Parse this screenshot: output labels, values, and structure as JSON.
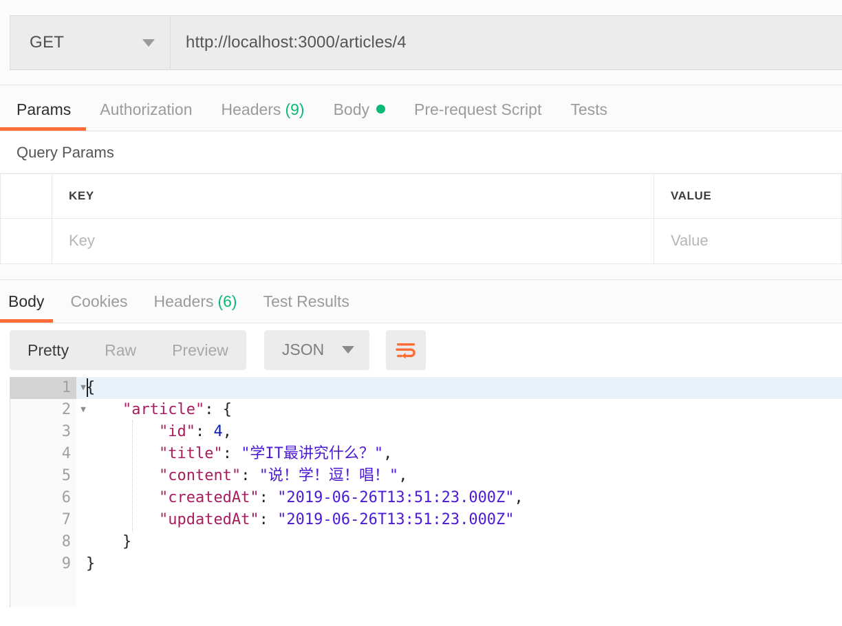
{
  "request": {
    "method": "GET",
    "url": "http://localhost:3000/articles/4",
    "method_caret": "chevron-down-icon",
    "tabs": [
      {
        "label": "Params",
        "active": true,
        "count": "",
        "dot": false
      },
      {
        "label": "Authorization",
        "active": false,
        "count": "",
        "dot": false
      },
      {
        "label": "Headers",
        "active": false,
        "count": "(9)",
        "dot": false
      },
      {
        "label": "Body",
        "active": false,
        "count": "",
        "dot": true
      },
      {
        "label": "Pre-request Script",
        "active": false,
        "count": "",
        "dot": false
      },
      {
        "label": "Tests",
        "active": false,
        "count": "",
        "dot": false
      }
    ]
  },
  "query_params": {
    "section_title": "Query Params",
    "headers": {
      "key": "KEY",
      "value": "VALUE"
    },
    "rows": [
      {
        "key_placeholder": "Key",
        "value_placeholder": "Value"
      }
    ]
  },
  "response": {
    "tabs": [
      {
        "label": "Body",
        "active": true,
        "count": ""
      },
      {
        "label": "Cookies",
        "active": false,
        "count": ""
      },
      {
        "label": "Headers",
        "active": false,
        "count": "(6)"
      },
      {
        "label": "Test Results",
        "active": false,
        "count": ""
      }
    ],
    "view_modes": [
      {
        "label": "Pretty",
        "active": true
      },
      {
        "label": "Raw",
        "active": false
      },
      {
        "label": "Preview",
        "active": false
      }
    ],
    "format": "JSON",
    "wrap_icon": "word-wrap-icon",
    "accent_color": "#ff6c37",
    "badge_color": "#0cb977"
  },
  "code": {
    "lines": [
      {
        "num": "1",
        "foldable": true,
        "active": true,
        "tokens": [
          {
            "t": "p",
            "v": "{"
          }
        ]
      },
      {
        "num": "2",
        "foldable": true,
        "active": false,
        "tokens": [
          {
            "t": "p",
            "v": "    "
          },
          {
            "t": "k",
            "v": "\"article\""
          },
          {
            "t": "p",
            "v": ": {"
          }
        ]
      },
      {
        "num": "3",
        "foldable": false,
        "active": false,
        "tokens": [
          {
            "t": "p",
            "v": "        "
          },
          {
            "t": "k",
            "v": "\"id\""
          },
          {
            "t": "p",
            "v": ": "
          },
          {
            "t": "n",
            "v": "4"
          },
          {
            "t": "p",
            "v": ","
          }
        ]
      },
      {
        "num": "4",
        "foldable": false,
        "active": false,
        "tokens": [
          {
            "t": "p",
            "v": "        "
          },
          {
            "t": "k",
            "v": "\"title\""
          },
          {
            "t": "p",
            "v": ": "
          },
          {
            "t": "s",
            "v": "\"学IT最讲究什么？\""
          },
          {
            "t": "p",
            "v": ","
          }
        ]
      },
      {
        "num": "5",
        "foldable": false,
        "active": false,
        "tokens": [
          {
            "t": "p",
            "v": "        "
          },
          {
            "t": "k",
            "v": "\"content\""
          },
          {
            "t": "p",
            "v": ": "
          },
          {
            "t": "s",
            "v": "\"说！学！逗！唱！\""
          },
          {
            "t": "p",
            "v": ","
          }
        ]
      },
      {
        "num": "6",
        "foldable": false,
        "active": false,
        "tokens": [
          {
            "t": "p",
            "v": "        "
          },
          {
            "t": "k",
            "v": "\"createdAt\""
          },
          {
            "t": "p",
            "v": ": "
          },
          {
            "t": "s",
            "v": "\"2019-06-26T13:51:23.000Z\""
          },
          {
            "t": "p",
            "v": ","
          }
        ]
      },
      {
        "num": "7",
        "foldable": false,
        "active": false,
        "tokens": [
          {
            "t": "p",
            "v": "        "
          },
          {
            "t": "k",
            "v": "\"updatedAt\""
          },
          {
            "t": "p",
            "v": ": "
          },
          {
            "t": "s",
            "v": "\"2019-06-26T13:51:23.000Z\""
          }
        ]
      },
      {
        "num": "8",
        "foldable": false,
        "active": false,
        "tokens": [
          {
            "t": "p",
            "v": "    }"
          }
        ]
      },
      {
        "num": "9",
        "foldable": false,
        "active": false,
        "tokens": [
          {
            "t": "p",
            "v": "}"
          }
        ]
      }
    ]
  }
}
